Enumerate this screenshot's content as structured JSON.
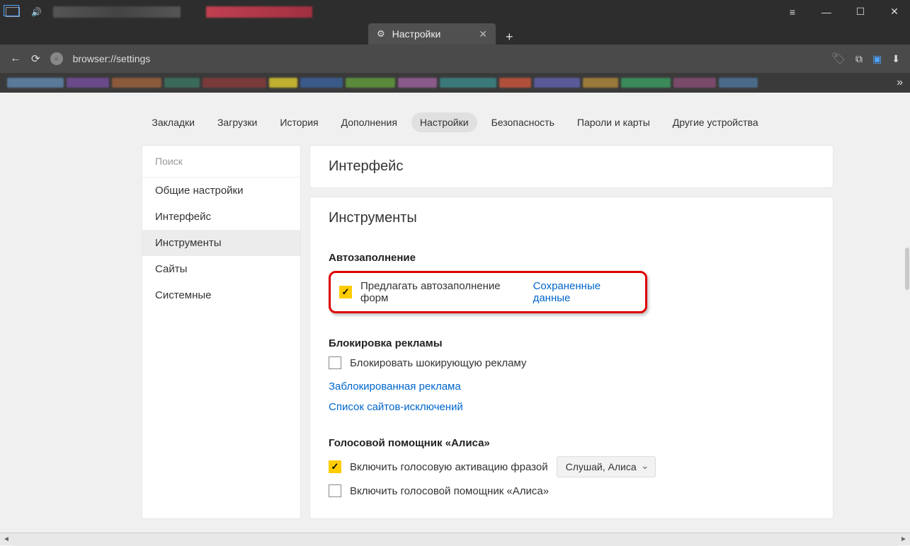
{
  "tab": {
    "title": "Настройки"
  },
  "url": "browser://settings",
  "topnav": {
    "items": [
      "Закладки",
      "Загрузки",
      "История",
      "Дополнения",
      "Настройки",
      "Безопасность",
      "Пароли и карты",
      "Другие устройства"
    ],
    "active_index": 4
  },
  "sidebar": {
    "search_placeholder": "Поиск",
    "items": [
      "Общие настройки",
      "Интерфейс",
      "Инструменты",
      "Сайты",
      "Системные"
    ],
    "active_index": 2
  },
  "panels": {
    "interface_title": "Интерфейс",
    "tools_title": "Инструменты"
  },
  "autofill": {
    "section_title": "Автозаполнение",
    "checkbox_label": "Предлагать автозаполнение форм",
    "checkbox_checked": true,
    "link_label": "Сохраненные данные"
  },
  "adblock": {
    "section_title": "Блокировка рекламы",
    "checkbox_label": "Блокировать шокирующую рекламу",
    "checkbox_checked": false,
    "link1": "Заблокированная реклама",
    "link2": "Список сайтов-исключений"
  },
  "alisa": {
    "section_title": "Голосовой помощник «Алиса»",
    "activation_label": "Включить голосовую активацию фразой",
    "activation_checked": true,
    "phrase_selected": "Слушай, Алиса",
    "enable_label": "Включить голосовой помощник «Алиса»",
    "enable_checked": false
  }
}
